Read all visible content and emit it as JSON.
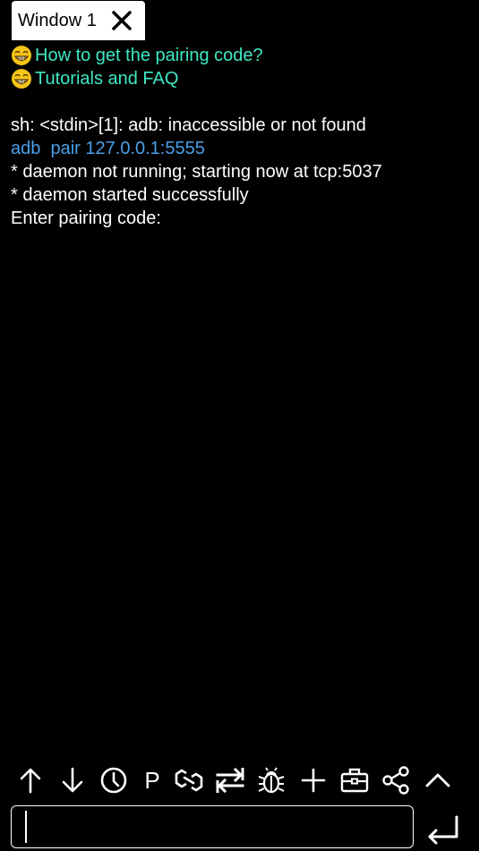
{
  "tab": {
    "title": "Window 1"
  },
  "links": [
    {
      "label": "How to get the pairing code?"
    },
    {
      "label": "Tutorials and FAQ"
    }
  ],
  "terminal": {
    "lines": [
      {
        "text": "sh: <stdin>[1]: adb: inaccessible or not found",
        "kind": "output"
      },
      {
        "text": "adb  pair 127.0.0.1:5555",
        "kind": "command"
      },
      {
        "text": "* daemon not running; starting now at tcp:5037",
        "kind": "output"
      },
      {
        "text": "* daemon started successfully",
        "kind": "output"
      },
      {
        "text": "Enter pairing code:",
        "kind": "output"
      }
    ]
  },
  "toolbar": {
    "p_label": "P",
    "icons": [
      "arrow-up-icon",
      "arrow-down-icon",
      "clock-icon",
      "p-icon",
      "link-icon",
      "swap-icon",
      "bug-icon",
      "plus-icon",
      "toolbox-icon",
      "share-icon",
      "chevron-up-icon"
    ]
  },
  "input": {
    "value": "",
    "placeholder": ""
  },
  "colors": {
    "background": "#000000",
    "link": "#3ee8c4",
    "command": "#4a9fe8",
    "text": "#ffffff"
  }
}
